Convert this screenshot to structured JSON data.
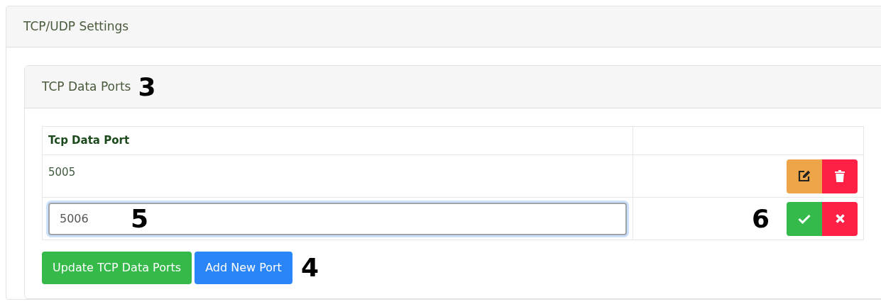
{
  "panel": {
    "title": "TCP/UDP Settings"
  },
  "section": {
    "title": "TCP Data Ports",
    "marker": "3"
  },
  "table": {
    "columns": [
      "Tcp Data Port",
      ""
    ],
    "rows": [
      {
        "kind": "display",
        "value": "5005"
      },
      {
        "kind": "editing",
        "value": "5006",
        "field_marker": "5",
        "actions_marker": "6"
      }
    ]
  },
  "buttons": [
    {
      "label": "Update TCP Data Ports",
      "kind": "success"
    },
    {
      "label": "Add New Port",
      "kind": "primary"
    }
  ],
  "buttons_marker": "4"
}
